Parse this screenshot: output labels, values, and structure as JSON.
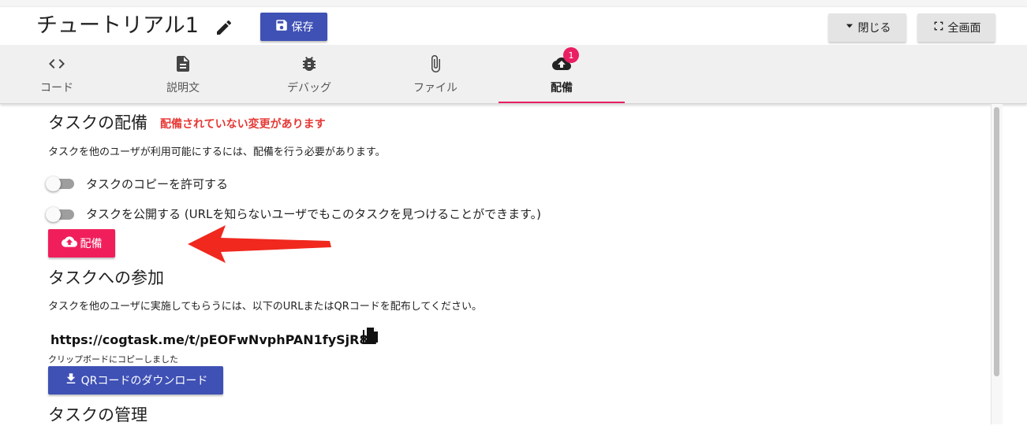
{
  "header": {
    "title": "チュートリアル1",
    "save_label": "保存",
    "close_label": "閉じる",
    "fullscreen_label": "全画面"
  },
  "tabs": [
    {
      "label": "コード",
      "icon": "code-icon"
    },
    {
      "label": "説明文",
      "icon": "description-icon"
    },
    {
      "label": "デバッグ",
      "icon": "bug-icon"
    },
    {
      "label": "ファイル",
      "icon": "paperclip-icon"
    },
    {
      "label": "配備",
      "icon": "cloud-upload-icon",
      "active": true,
      "badge": "1"
    }
  ],
  "deploy": {
    "heading": "タスクの配備",
    "warning": "配備されていない変更があります",
    "description": "タスクを他のユーザが利用可能にするには、配備を行う必要があります。",
    "allow_copy_label": "タスクのコピーを許可する",
    "allow_copy_on": false,
    "publish_label": "タスクを公開する (URLを知らないユーザでもこのタスクを見つけることができます。)",
    "publish_on": false,
    "button_label": "配備"
  },
  "join": {
    "heading": "タスクへの参加",
    "description": "タスクを他のユーザに実施してもらうには、以下のURLまたはQRコードを配布してください。",
    "url": "https://cogtask.me/t/pEOFwNvphPAN1fySjR8n",
    "copied_message": "クリップボードにコピーしました",
    "qr_button_label": "QRコードのダウンロード"
  },
  "manage": {
    "heading": "タスクの管理"
  },
  "colors": {
    "primary": "#3f51b5",
    "accent": "#e91e63",
    "deploy_button": "#f01f5c",
    "warning": "#e53935",
    "annotation_arrow": "#f0281e"
  }
}
